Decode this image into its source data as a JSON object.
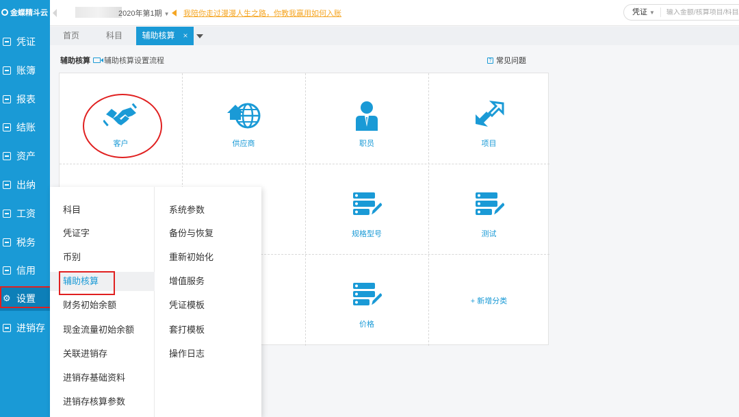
{
  "app": {
    "logo_text": "金蝶精斗云"
  },
  "sidebar": {
    "items": [
      {
        "label": "凭证"
      },
      {
        "label": "账簿"
      },
      {
        "label": "报表"
      },
      {
        "label": "结账"
      },
      {
        "label": "资产"
      },
      {
        "label": "出纳"
      },
      {
        "label": "工资"
      },
      {
        "label": "税务"
      },
      {
        "label": "信用"
      },
      {
        "label": "设置",
        "active": true
      },
      {
        "label": "进销存"
      }
    ]
  },
  "topbar": {
    "period": "2020年第1期",
    "notice": "我陪你走过漫漫人生之路，你教我赢用如何入账",
    "search_type": "凭证",
    "search_placeholder": "输入金额/核算项目/科目/摘要"
  },
  "tabs": [
    {
      "label": "首页"
    },
    {
      "label": "科目"
    },
    {
      "label": "辅助核算",
      "active": true,
      "close": "×"
    }
  ],
  "section": {
    "title": "辅助核算",
    "process_link": "辅助核算设置流程",
    "faq_link": "常见问题"
  },
  "grid": {
    "cells": [
      {
        "label": "客户",
        "icon": "handshake-icon"
      },
      {
        "label": "供应商",
        "icon": "globe-house-icon"
      },
      {
        "label": "职员",
        "icon": "employee-icon"
      },
      {
        "label": "项目",
        "icon": "expand-arrows-icon"
      },
      {
        "label": "规格型号",
        "icon": "list-edit-icon"
      },
      {
        "label": "测试",
        "icon": "list-edit-icon"
      },
      {
        "label": "价格",
        "icon": "list-edit-icon"
      },
      {
        "label": "+ 新增分类",
        "icon": ""
      }
    ]
  },
  "menu": {
    "left": [
      {
        "label": "科目"
      },
      {
        "label": "凭证字"
      },
      {
        "label": "币别"
      },
      {
        "label": "辅助核算",
        "active": true
      },
      {
        "label": "财务初始余额"
      },
      {
        "label": "现金流量初始余额"
      },
      {
        "label": "关联进销存"
      },
      {
        "label": "进销存基础资料"
      },
      {
        "label": "进销存核算参数"
      }
    ],
    "right": [
      {
        "label": "系统参数"
      },
      {
        "label": "备份与恢复"
      },
      {
        "label": "重新初始化"
      },
      {
        "label": "增值服务"
      },
      {
        "label": "凭证模板"
      },
      {
        "label": "套打模板"
      },
      {
        "label": "操作日志"
      }
    ]
  },
  "colors": {
    "primary": "#1a9ad6",
    "highlight": "#e02020",
    "notice": "#f5a623"
  }
}
